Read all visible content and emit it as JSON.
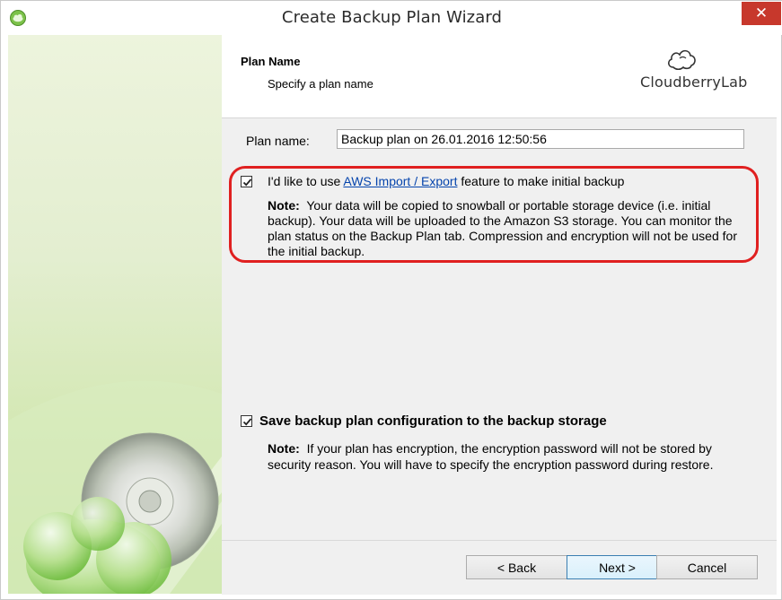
{
  "window": {
    "title": "Create Backup Plan Wizard",
    "close_glyph": "✕",
    "accent_close": "#c7382c"
  },
  "header": {
    "title": "Plan Name",
    "subtitle": "Specify a plan name",
    "logo_text": "CloudberryLab"
  },
  "plan_name": {
    "label": "Plan name:",
    "value": "Backup plan on 26.01.2016 12:50:56"
  },
  "aws_option": {
    "checked": true,
    "text_before": "I'd like to use ",
    "link_text": "AWS Import / Export",
    "text_after": " feature to make initial backup",
    "note_label": "Note:",
    "note_text": "Your data will be copied to snowball or portable storage device (i.e. initial backup). Your data will be uploaded to the Amazon S3 storage. You can monitor the plan status on the Backup Plan tab. Compression and encryption will not be used for the initial backup.",
    "highlight_color": "#e02020"
  },
  "save_config": {
    "checked": true,
    "label": "Save backup plan configuration to the backup storage",
    "note_label": "Note:",
    "note_text": "If your plan has encryption, the encryption password will not be stored by security reason. You will have to specify the encryption password during restore."
  },
  "footer": {
    "back_label": "< Back",
    "next_label": "Next >",
    "cancel_label": "Cancel"
  }
}
